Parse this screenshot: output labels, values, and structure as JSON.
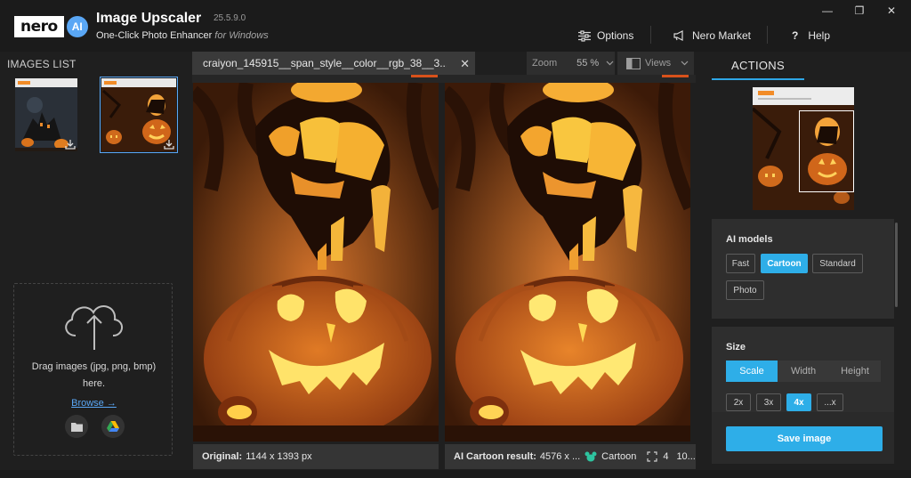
{
  "app": {
    "logo_text": "nero",
    "logo_ai": "AI",
    "title": "Image Upscaler",
    "version": "25.5.9.0",
    "subtitle": "One-Click Photo Enhancer",
    "subtitle_for": "for Windows"
  },
  "topnav": {
    "options_label": "Options",
    "market_label": "Nero Market",
    "help_icon": "?",
    "help_label": "Help"
  },
  "window_controls": {
    "minimize": "—",
    "restore": "❐",
    "close": "✕"
  },
  "left": {
    "title": "IMAGES LIST",
    "drop_text_line1": "Drag images (jpg, png, bmp)",
    "drop_text_line2": "here.",
    "browse_label": "Browse →"
  },
  "tab": {
    "filename": "craiyon_145915__span_style__color__rgb_38__3...",
    "zoom_label": "Zoom",
    "zoom_value": "55 %",
    "views_label": "Views"
  },
  "captions": {
    "original_label": "Original:",
    "original_value": "1144 x 1393 px",
    "result_label": "AI Cartoon result:",
    "result_value": "4576 x ...",
    "result_model": "Cartoon",
    "result_scale": "4",
    "result_more": "10..."
  },
  "right": {
    "actions_title": "ACTIONS",
    "ai_models_title": "AI models",
    "models": [
      "Fast",
      "Cartoon",
      "Standard",
      "Photo"
    ],
    "active_model": "Cartoon",
    "size_title": "Size",
    "size_tabs": [
      "Scale",
      "Width",
      "Height"
    ],
    "active_size_tab": "Scale",
    "scales": [
      "2x",
      "3x",
      "4x",
      "...x"
    ],
    "active_scale": "4x",
    "save_label": "Save image"
  },
  "colors": {
    "accent": "#2eaee8",
    "background": "#1f1f1f",
    "panel": "#2e2e2e"
  }
}
